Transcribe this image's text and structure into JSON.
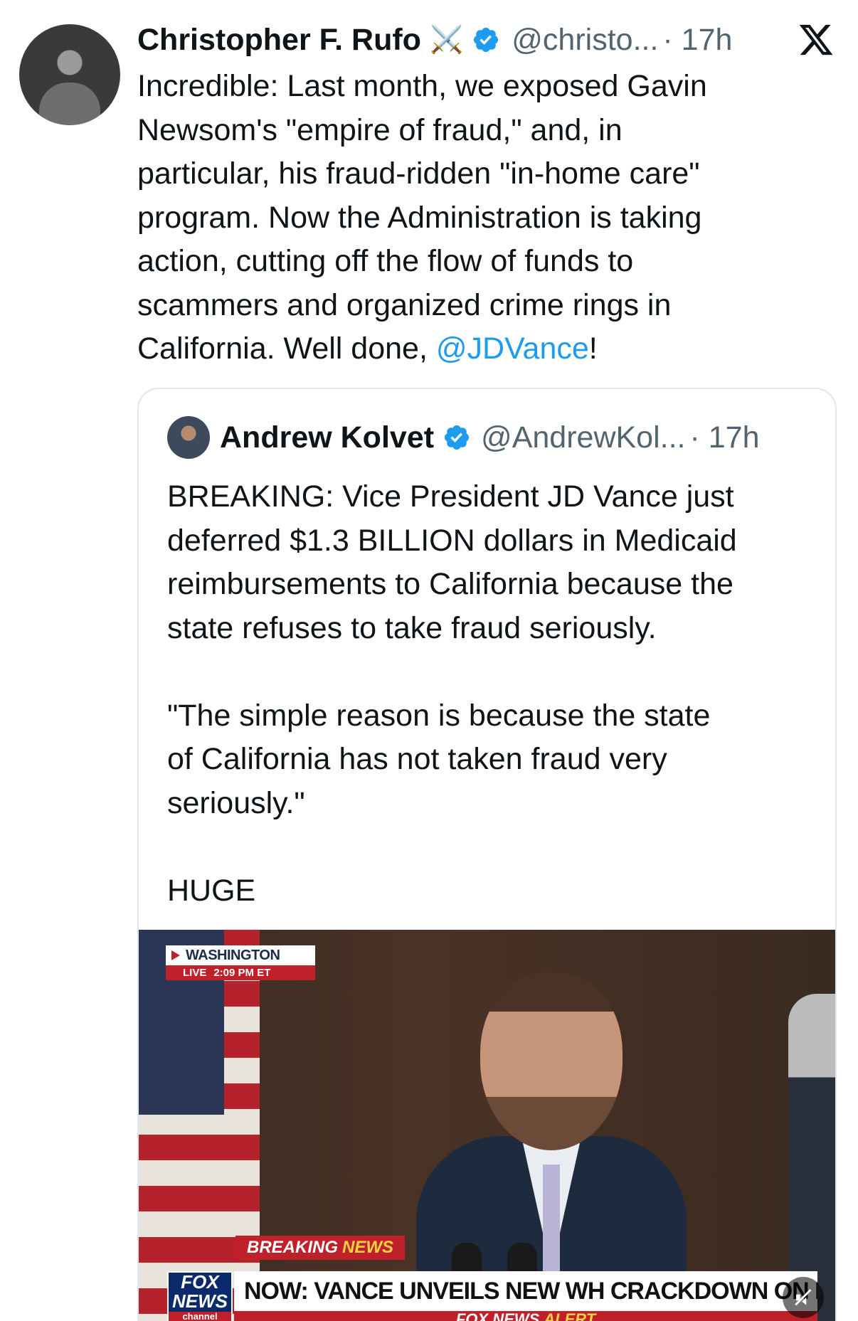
{
  "author": {
    "name": "Christopher F. Rufo",
    "badge_emoji": "⚔️",
    "handle": "@christo...",
    "time": "· 17h"
  },
  "tweet": {
    "text": "Incredible: Last month, we exposed Gavin\nNewsom's \"empire of fraud,\" and, in\nparticular, his fraud-ridden \"in-home care\"\nprogram. Now the Administration is taking\naction, cutting off the flow of funds to\nscammers and organized crime rings in\nCalifornia. Well done, ",
    "mention": "@JDVance",
    "text_end": "!"
  },
  "quoted": {
    "name": "Andrew Kolvet",
    "handle": "@AndrewKol...",
    "time": "· 17h",
    "text": "BREAKING: Vice President JD Vance just\ndeferred $1.3 BILLION dollars in Medicaid\nreimbursements to California because the\nstate refuses to take fraud seriously.\n\n\"The simple reason is because the state\nof California has not taken fraud very\nseriously.\"\n\nHUGE"
  },
  "video": {
    "location": "WASHINGTON",
    "live_label": "LIVE",
    "live_time": "2:09 PM ET",
    "breaking_label": "BREAKING",
    "breaking_news": "NEWS",
    "network_logo_top": "FOX",
    "network_logo_mid": "NEWS",
    "network_logo_bottom": "channel",
    "headline": "NOW: VANCE UNVEILS NEW WH CRACKDOWN ON FRAUD",
    "alert_brand": "FOX NEWS",
    "alert_word": "ALERT"
  },
  "colors": {
    "accent": "#1d9bf0",
    "secondary_text": "#536471",
    "fox_red": "#c0202a",
    "fox_blue": "#0b2a6b"
  },
  "icons": {
    "verified": "verified-badge-icon",
    "x_logo": "x-logo-icon",
    "mute": "muted-speaker-icon"
  }
}
